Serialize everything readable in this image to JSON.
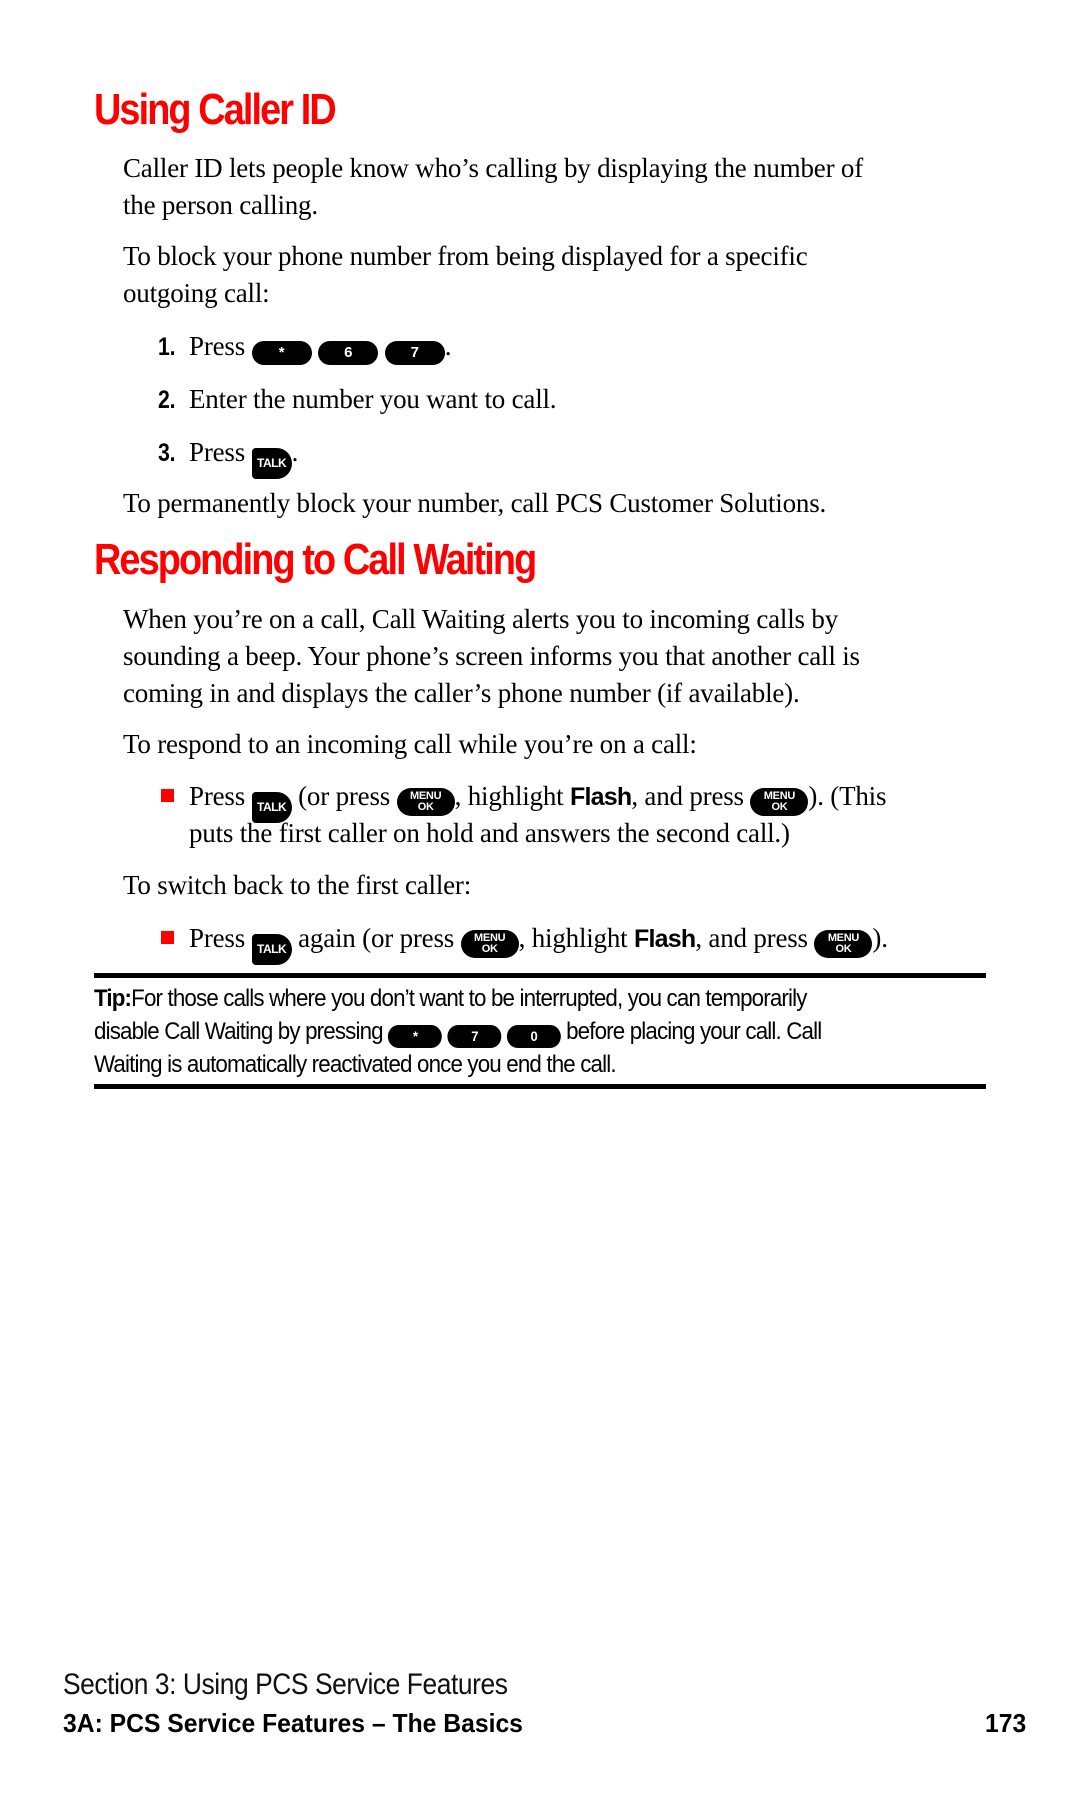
{
  "section1": {
    "heading": "Using Caller ID",
    "para1_line1": "Caller ID lets people know who’s calling by displaying the number of",
    "para1_line2": "the person calling.",
    "para2_line1": "To block your phone number from being displayed for a specific",
    "para2_line2": "outgoing call:",
    "steps": [
      {
        "number": "1.",
        "text": "Press",
        "keys": [
          "*",
          "6",
          "7"
        ],
        "suffix": "."
      },
      {
        "number": "2.",
        "text": "Enter the number you want to call."
      },
      {
        "number": "3.",
        "text": "Press",
        "key": "TALK",
        "suffix": "."
      }
    ],
    "note": "To permanently block your number, call PCS Customer Solutions."
  },
  "section2": {
    "heading": "Responding to Call Waiting",
    "para1_lines": [
      "When you’re on a call, Call Waiting alerts you to incoming calls by",
      "sounding a beep. Your phone’s screen informs you that another call is",
      "coming in and displays the caller’s phone number (if available)."
    ],
    "respond_intro": "To respond to an incoming call while you’re on a call:",
    "bullet1": {
      "press": "Press",
      "or_press": "(or press",
      "highlight": ", highlight",
      "flash": "Flash",
      "and_press": ", and press",
      "close": "). (This",
      "line2": "puts the first caller on hold and answers the second call.)"
    },
    "switch_intro": "To switch back to the first caller:",
    "bullet2": {
      "press": "Press",
      "again": "again (or press",
      "highlight": ", highlight",
      "flash": "Flash",
      "and_press": ", and press",
      "close": ")."
    },
    "keys": {
      "talk": "TALK",
      "menu_top": "MENU",
      "menu_bottom": "OK"
    }
  },
  "tip": {
    "label": "Tip:",
    "line1": "For those calls where you don’t want to be interrupted, you can temporarily",
    "line2_pre": "disable Call Waiting by pressing",
    "keys": [
      "*",
      "7",
      "0"
    ],
    "line2_post": "before placing your call. Call",
    "line3": "Waiting is automatically reactivated once you end the call."
  },
  "footer": {
    "section": "Section 3: Using PCS Service Features",
    "chapter": "3A: PCS Service Features – The Basics",
    "page_number": "173"
  },
  "colors": {
    "heading": "#ff0000",
    "bullet": "#ff0000",
    "text": "#000000"
  }
}
